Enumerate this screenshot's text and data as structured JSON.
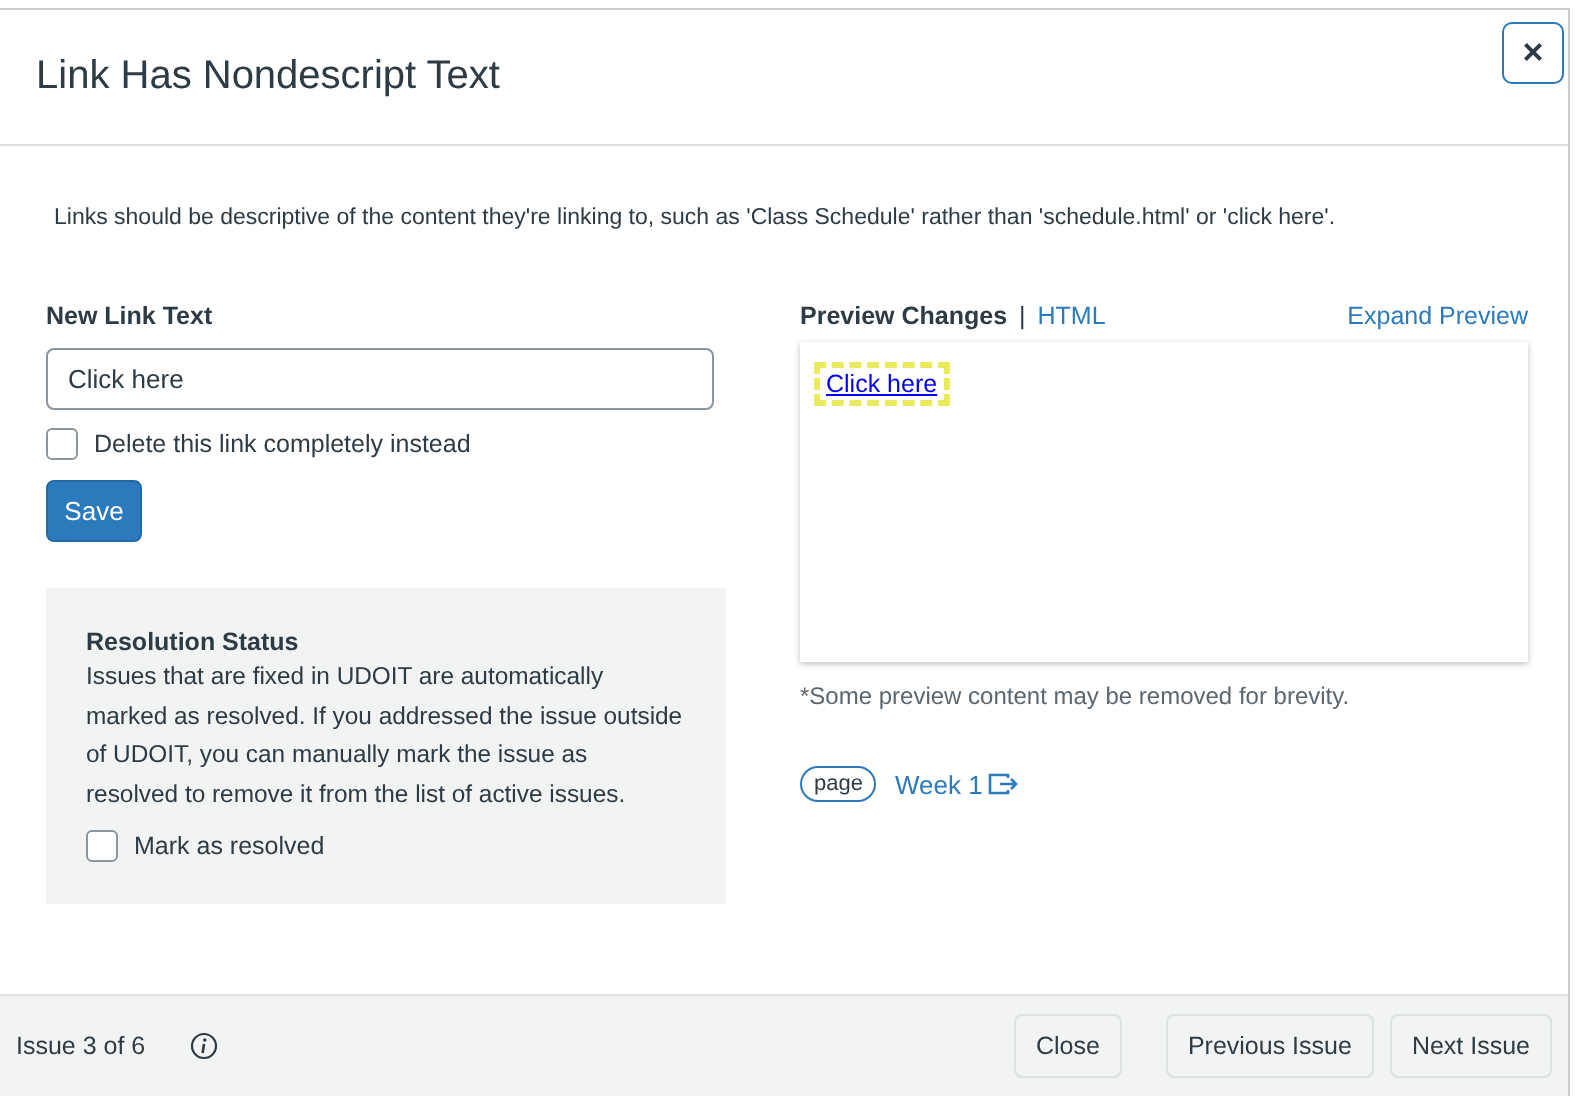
{
  "dialog": {
    "title": "Link Has Nondescript Text",
    "close_label": "×"
  },
  "description": "Links should be descriptive of the content they're linking to, such as 'Class Schedule' rather than 'schedule.html' or 'click here'.",
  "form": {
    "label": "New Link Text",
    "value": "Click here",
    "delete_option": {
      "label": "Delete this link completely instead",
      "checked": false
    },
    "save_label": "Save"
  },
  "resolution": {
    "title": "Resolution Status",
    "text": "Issues that are fixed in UDOIT are automatically marked as resolved. If you addressed the issue outside of UDOIT, you can manually mark the issue as resolved to remove it from the list of active issues.",
    "option": {
      "label": "Mark as resolved",
      "checked": false
    }
  },
  "preview": {
    "views": [
      {
        "label": "Preview Changes",
        "selected": true
      },
      {
        "label": "HTML",
        "selected": false
      }
    ],
    "separator": "|",
    "expand_label": "Expand Preview",
    "link_text": "Click here",
    "note": "*Some preview content may be removed for brevity.",
    "content_type": "page",
    "content_title": "Week 1"
  },
  "footer": {
    "counter": "Issue 3 of 6",
    "buttons": [
      "Close",
      "Previous Issue",
      "Next Issue"
    ]
  }
}
